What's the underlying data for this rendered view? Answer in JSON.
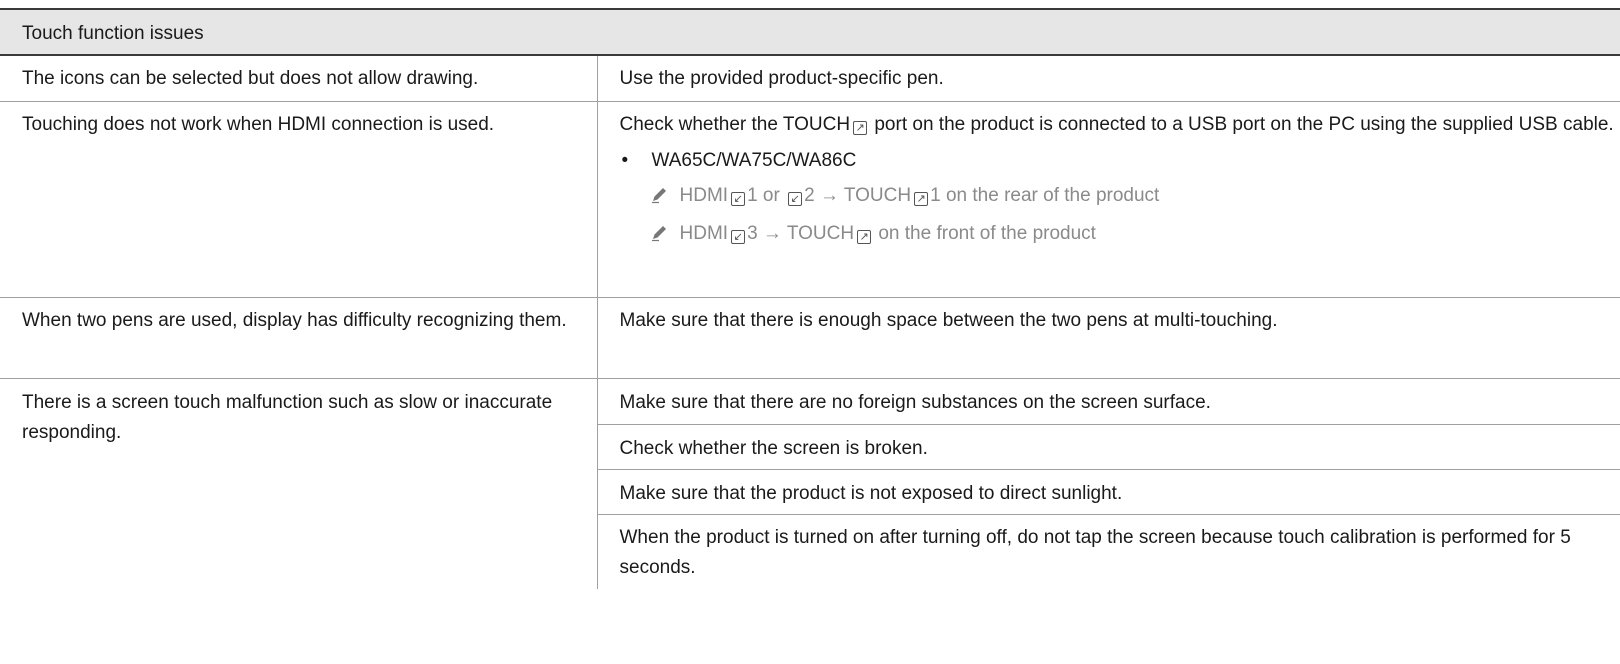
{
  "header": {
    "title": "Touch function issues"
  },
  "rows": [
    {
      "problem": "The icons can be selected but does not allow drawing.",
      "solutions": [
        "Use the provided product-specific pen."
      ]
    },
    {
      "problem": "Touching does not work when HDMI connection is used.",
      "solution_intro": {
        "before": "Check whether the ",
        "port": "TOUCH",
        "after": " port on the product is connected to a USB port on the PC using the supplied USB cable."
      },
      "model_bullet": "WA65C/WA75C/WA86C",
      "notes": [
        {
          "hdmi": "HDMI",
          "in1": "1",
          "or": " or ",
          "in2": "2",
          "arrow": " → ",
          "touch": "TOUCH",
          "touch_num": "1",
          "tail": " on the rear of the product"
        },
        {
          "hdmi": "HDMI",
          "in1": "3",
          "arrow": " → ",
          "touch": "TOUCH",
          "tail": " on the front of the product"
        }
      ]
    },
    {
      "problem": "When two pens are used, display has difficulty recognizing them.",
      "solutions": [
        "Make sure that there is enough space between the two pens at multi-touching."
      ]
    },
    {
      "problem": "There is a screen touch malfunction such as slow or inaccurate responding.",
      "solutions": [
        "Make sure that there are no foreign substances on the screen surface.",
        "Check whether the screen is broken.",
        "Make sure that the product is not exposed to direct sunlight.",
        "When the product is turned on after turning off, do not tap the screen because touch calibration is performed for 5 seconds."
      ]
    }
  ],
  "icons": {
    "port_in": "port-input-icon",
    "port_out": "port-output-icon",
    "note": "pencil-note-icon"
  }
}
